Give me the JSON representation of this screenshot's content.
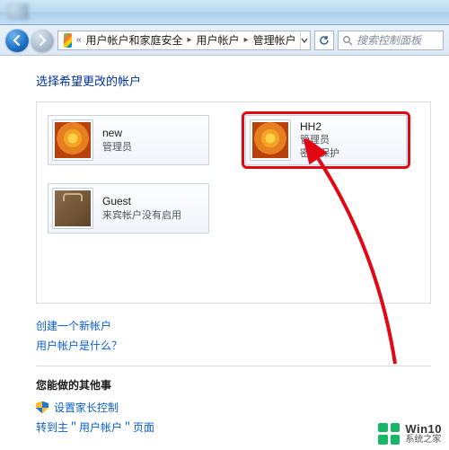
{
  "breadcrumb": {
    "crumb1": "用户帐户和家庭安全",
    "crumb2": "用户帐户",
    "crumb3": "管理帐户"
  },
  "search": {
    "placeholder": "搜索控制面板"
  },
  "page": {
    "heading": "选择希望更改的帐户"
  },
  "accounts": {
    "new": {
      "name": "new",
      "role": "管理员"
    },
    "hh2": {
      "name": "HH2",
      "role": "管理员",
      "protect": "密码保护"
    },
    "guest": {
      "name": "Guest",
      "status": "来宾帐户没有启用"
    }
  },
  "links": {
    "create_user": "创建一个新帐户",
    "what_is": "用户帐户是什么？"
  },
  "other": {
    "heading": "您能做的其他事",
    "parental": "设置家长控制",
    "goto_main": "转到主＂用户帐户＂页面"
  },
  "watermark": {
    "top": "Win10",
    "bottom": "系统之家"
  }
}
